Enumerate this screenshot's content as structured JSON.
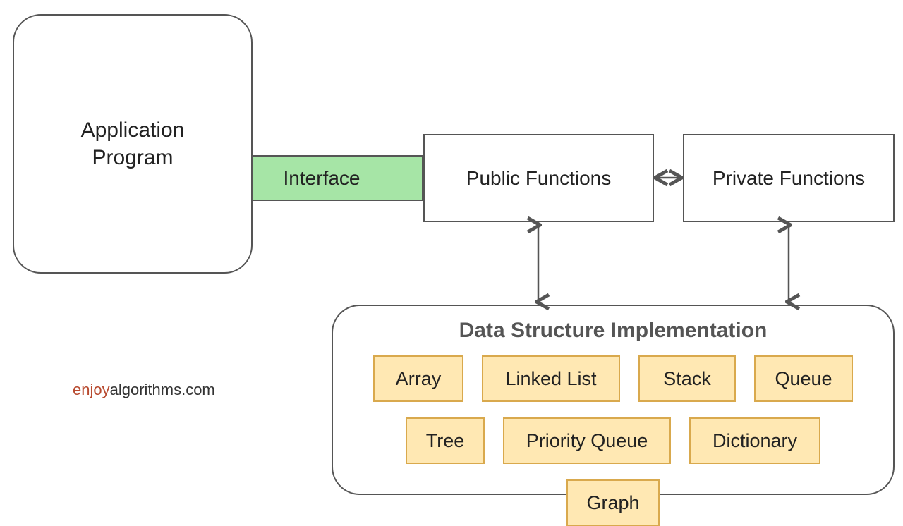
{
  "appProgram": {
    "line1": "Application",
    "line2": "Program"
  },
  "interface": {
    "label": "Interface"
  },
  "publicFunctions": {
    "label": "Public Functions"
  },
  "privateFunctions": {
    "label": "Private Functions"
  },
  "impl": {
    "title": "Data Structure Implementation",
    "items": {
      "array": "Array",
      "linkedList": "Linked List",
      "stack": "Stack",
      "queue": "Queue",
      "tree": "Tree",
      "priorityQueue": "Priority Queue",
      "dictionary": "Dictionary",
      "graph": "Graph"
    }
  },
  "credit": {
    "brand1": "enjoy",
    "brand2": "algorithms",
    "suffix": ".com"
  },
  "colors": {
    "border": "#555555",
    "interfaceFill": "#a6e5a6",
    "dsFill": "#ffe8b3",
    "dsBorder": "#d9a94d"
  }
}
